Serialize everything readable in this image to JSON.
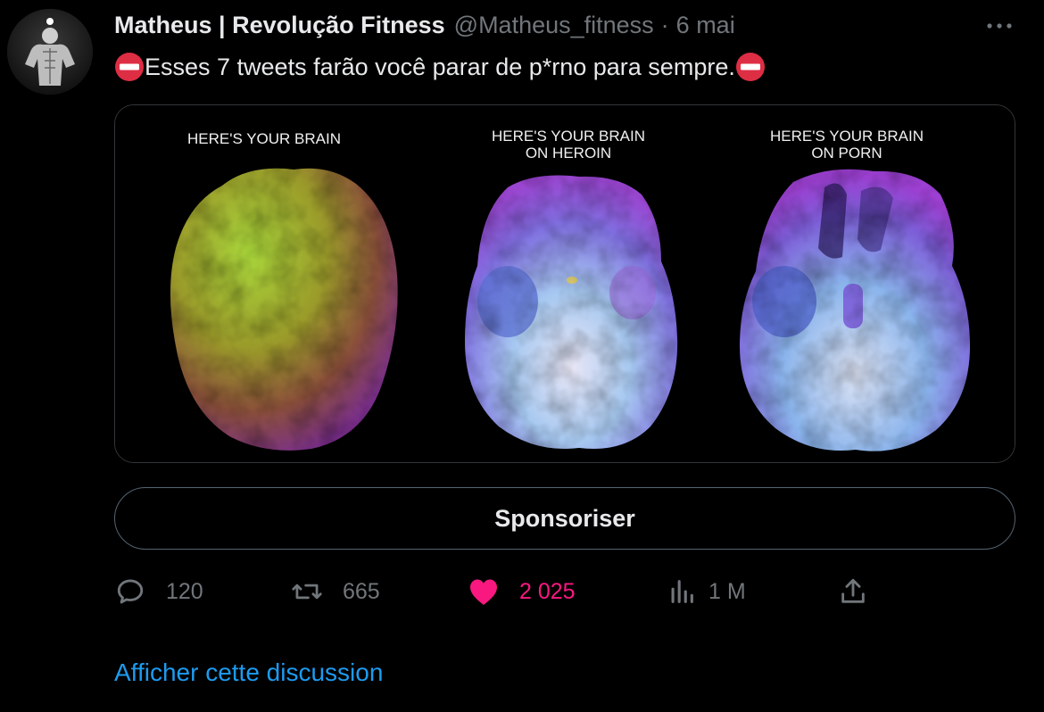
{
  "author": {
    "name": "Matheus | Revolução Fitness",
    "handle": "@Matheus_fitness",
    "separator": "·",
    "date": "6 mai"
  },
  "tweet": {
    "text": "Esses 7 tweets farão você parar de p*rno para sempre."
  },
  "media": {
    "panels": [
      {
        "caption_line1": "HERE'S YOUR BRAIN",
        "caption_line2": ""
      },
      {
        "caption_line1": "HERE'S YOUR BRAIN",
        "caption_line2": "ON HEROIN"
      },
      {
        "caption_line1": "HERE'S YOUR BRAIN",
        "caption_line2": "ON PORN"
      }
    ]
  },
  "sponsor_button": {
    "label": "Sponsoriser"
  },
  "actions": {
    "reply": {
      "icon": "reply-icon",
      "count": "120"
    },
    "retweet": {
      "icon": "retweet-icon",
      "count": "665"
    },
    "like": {
      "icon": "heart-icon",
      "count": "2 025"
    },
    "views": {
      "icon": "views-icon",
      "count": "1 M"
    },
    "share": {
      "icon": "share-icon"
    }
  },
  "show_thread": {
    "label": "Afficher cette discussion"
  },
  "colors": {
    "background": "#000000",
    "text_primary": "#e7e9ea",
    "text_secondary": "#71767b",
    "link": "#1d9bf0",
    "like": "#f91880",
    "no_entry_red": "#dd2e44"
  }
}
